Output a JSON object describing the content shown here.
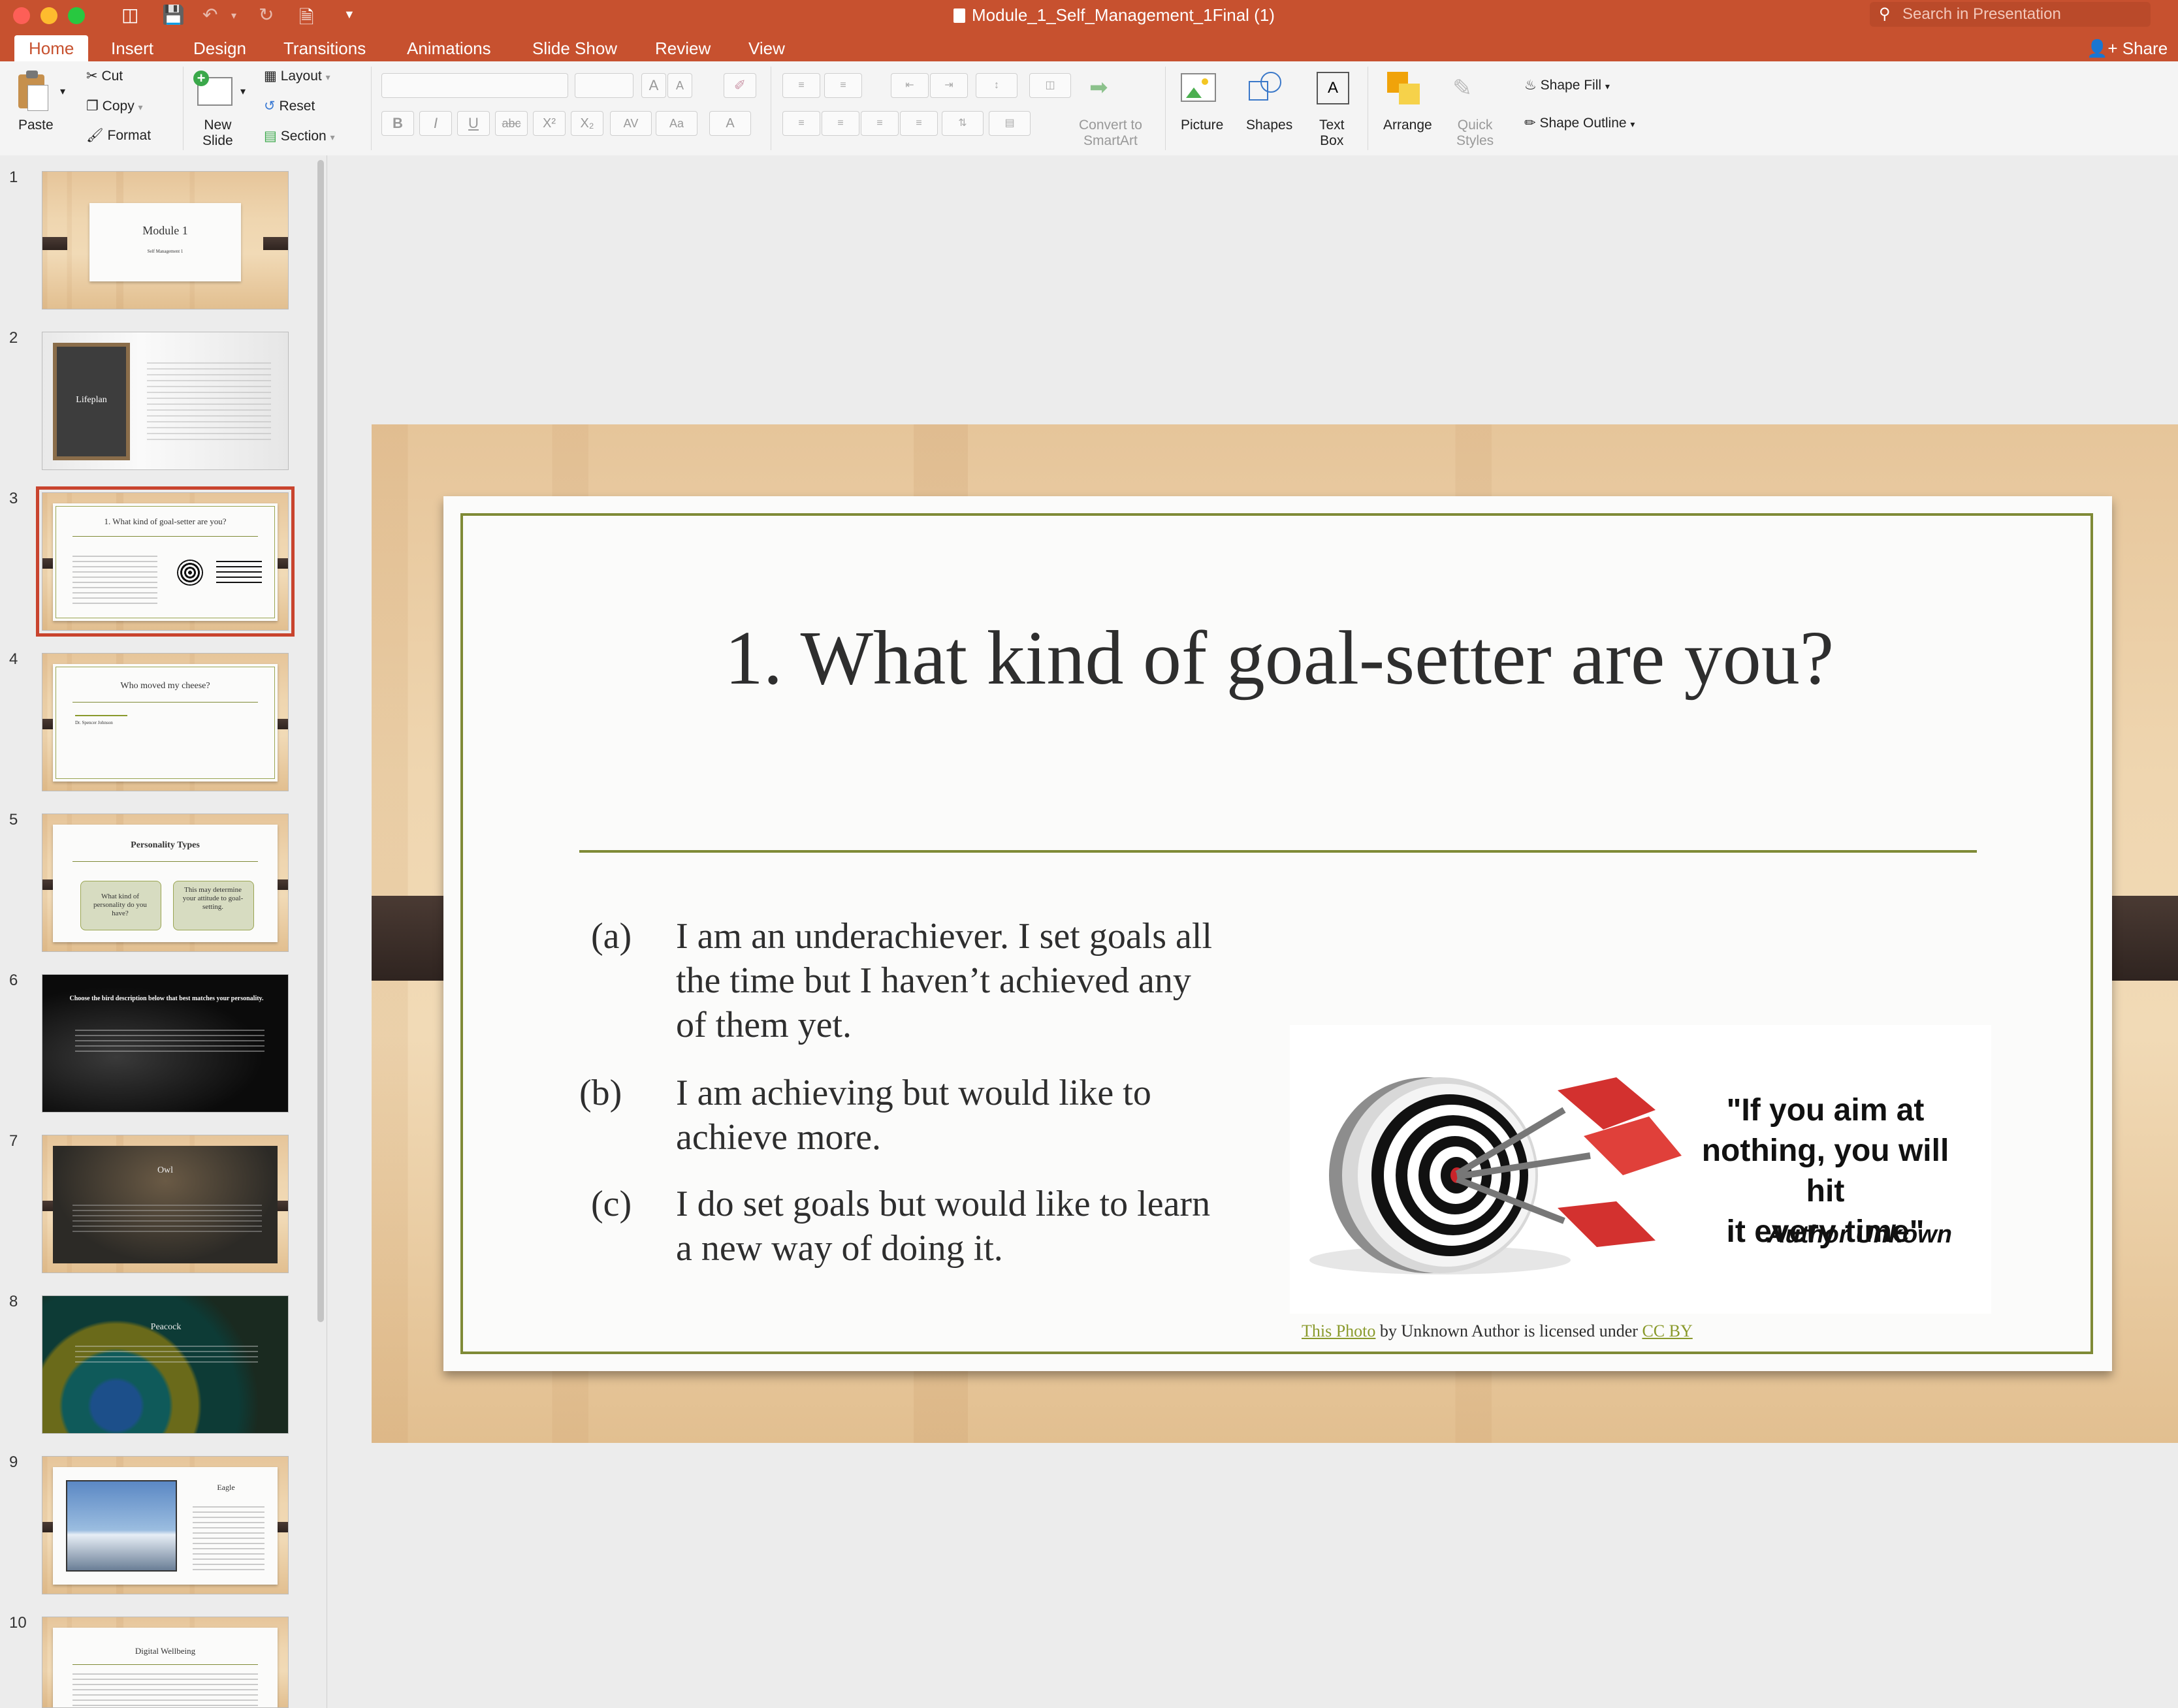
{
  "window": {
    "title": "Module_1_Self_Management_1Final (1)",
    "search_placeholder": "Search in Presentation",
    "share_label": "Share"
  },
  "tabs": [
    "Home",
    "Insert",
    "Design",
    "Transitions",
    "Animations",
    "Slide Show",
    "Review",
    "View"
  ],
  "active_tab": "Home",
  "ribbon": {
    "paste": "Paste",
    "cut": "Cut",
    "copy": "Copy",
    "format": "Format",
    "new_slide_1": "New",
    "new_slide_2": "Slide",
    "layout": "Layout",
    "reset": "Reset",
    "section": "Section",
    "convert_1": "Convert to",
    "convert_2": "SmartArt",
    "picture": "Picture",
    "shapes": "Shapes",
    "textbox_1": "Text",
    "textbox_2": "Box",
    "arrange": "Arrange",
    "quick_1": "Quick",
    "quick_2": "Styles",
    "shape_fill": "Shape Fill",
    "shape_outline": "Shape Outline"
  },
  "thumbnails": [
    {
      "num": "1",
      "title": "Module 1",
      "subtitle": "Self Management 1"
    },
    {
      "num": "2",
      "title": "Lifeplan"
    },
    {
      "num": "3",
      "title": "1. What kind of goal-setter are you?"
    },
    {
      "num": "4",
      "title": "Who moved my cheese?",
      "bullet": "Dr. Spencer Johnson"
    },
    {
      "num": "5",
      "title": "Personality Types",
      "box1": "What kind of personality do you have?",
      "box2": "This may determine your attitude to goal-setting."
    },
    {
      "num": "6",
      "title": "Choose the bird description below that best matches your personality."
    },
    {
      "num": "7",
      "title": "Owl"
    },
    {
      "num": "8",
      "title": "Peacock"
    },
    {
      "num": "9",
      "title": "Eagle"
    },
    {
      "num": "10",
      "title": "Digital Wellbeing"
    }
  ],
  "slide": {
    "title": "1. What kind of goal-setter are you?",
    "items": [
      {
        "marker": "(a)",
        "line1": "I am an underachiever.  I set goals all",
        "line2": "the time but I haven’t achieved any",
        "line3": "of  them yet."
      },
      {
        "marker": "(b)",
        "line1": "I am achieving but would like to",
        "line2": "achieve more."
      },
      {
        "marker": "(c)",
        "line1": "I do set goals but would like to learn",
        "line2": "a new way of  doing it."
      }
    ],
    "quote_lines": [
      "\"If you aim at",
      "nothing, you will hit",
      "it every time\""
    ],
    "quote_author": "Author Unkown",
    "credit_link": "This Photo",
    "credit_mid": " by Unknown Author is licensed under ",
    "credit_license": "CC BY"
  },
  "colors": {
    "accent": "#c7512f",
    "rule": "#7f8a36",
    "link": "#8a9a2c"
  }
}
